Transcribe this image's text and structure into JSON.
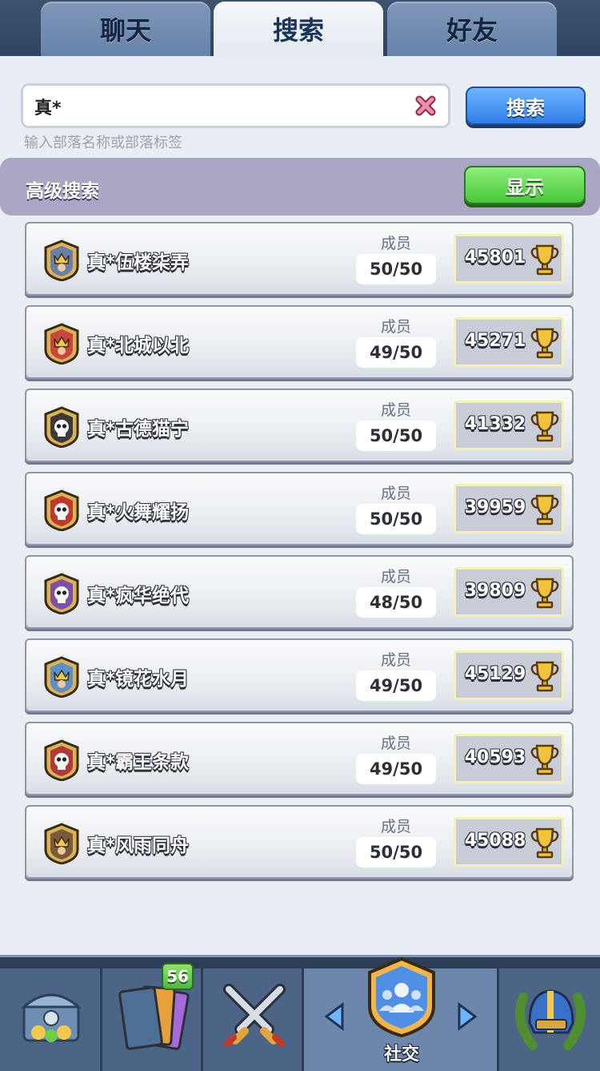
{
  "tabs": [
    {
      "label": "聊天",
      "active": false
    },
    {
      "label": "搜索",
      "active": true
    },
    {
      "label": "好友",
      "active": false
    }
  ],
  "search": {
    "value": "真*",
    "placeholder": "",
    "hint": "输入部落名称或部落标签",
    "button_label": "搜索"
  },
  "advanced": {
    "label": "高级搜索",
    "button_label": "显示"
  },
  "clans": [
    {
      "name": "真*伍楼柒弄",
      "members_label": "成员",
      "members": "50/50",
      "trophies": "45801",
      "badge_icon": "king-crown-badge-icon",
      "badge_color": "#6a7fa8"
    },
    {
      "name": "真*北城以北",
      "members_label": "成员",
      "members": "49/50",
      "trophies": "45271",
      "badge_icon": "king-crown-badge-icon",
      "badge_color": "#c9463c"
    },
    {
      "name": "真*古德猫宁",
      "members_label": "成员",
      "members": "50/50",
      "trophies": "41332",
      "badge_icon": "skull-badge-icon",
      "badge_color": "#3a3a3a"
    },
    {
      "name": "真*火舞耀扬",
      "members_label": "成员",
      "members": "50/50",
      "trophies": "39959",
      "badge_icon": "skull-badge-icon",
      "badge_color": "#c0392b"
    },
    {
      "name": "真*疯华绝代",
      "members_label": "成员",
      "members": "48/50",
      "trophies": "39809",
      "badge_icon": "skull-badge-icon",
      "badge_color": "#7d4fa8"
    },
    {
      "name": "真*镜花水月",
      "members_label": "成员",
      "members": "49/50",
      "trophies": "45129",
      "badge_icon": "king-crown-badge-icon",
      "badge_color": "#5a8fc9"
    },
    {
      "name": "真*霸王条款",
      "members_label": "成员",
      "members": "49/50",
      "trophies": "40593",
      "badge_icon": "skull-badge-icon",
      "badge_color": "#b03a3a"
    },
    {
      "name": "真*风雨同舟",
      "members_label": "成员",
      "members": "50/50",
      "trophies": "45088",
      "badge_icon": "king-crown-badge-icon",
      "badge_color": "#7a5a3a"
    }
  ],
  "bottom_nav": {
    "items": [
      {
        "icon": "chest-icon"
      },
      {
        "icon": "cards-icon",
        "badge": "56"
      },
      {
        "icon": "crossed-swords-icon"
      },
      {
        "icon": "social-icon",
        "label": "社交",
        "active": true
      },
      {
        "icon": "helmet-laurel-icon"
      }
    ]
  },
  "colors": {
    "accent_blue": "#2f7ee8",
    "accent_green": "#46c73a",
    "advanced_bar": "#aba6c3"
  }
}
